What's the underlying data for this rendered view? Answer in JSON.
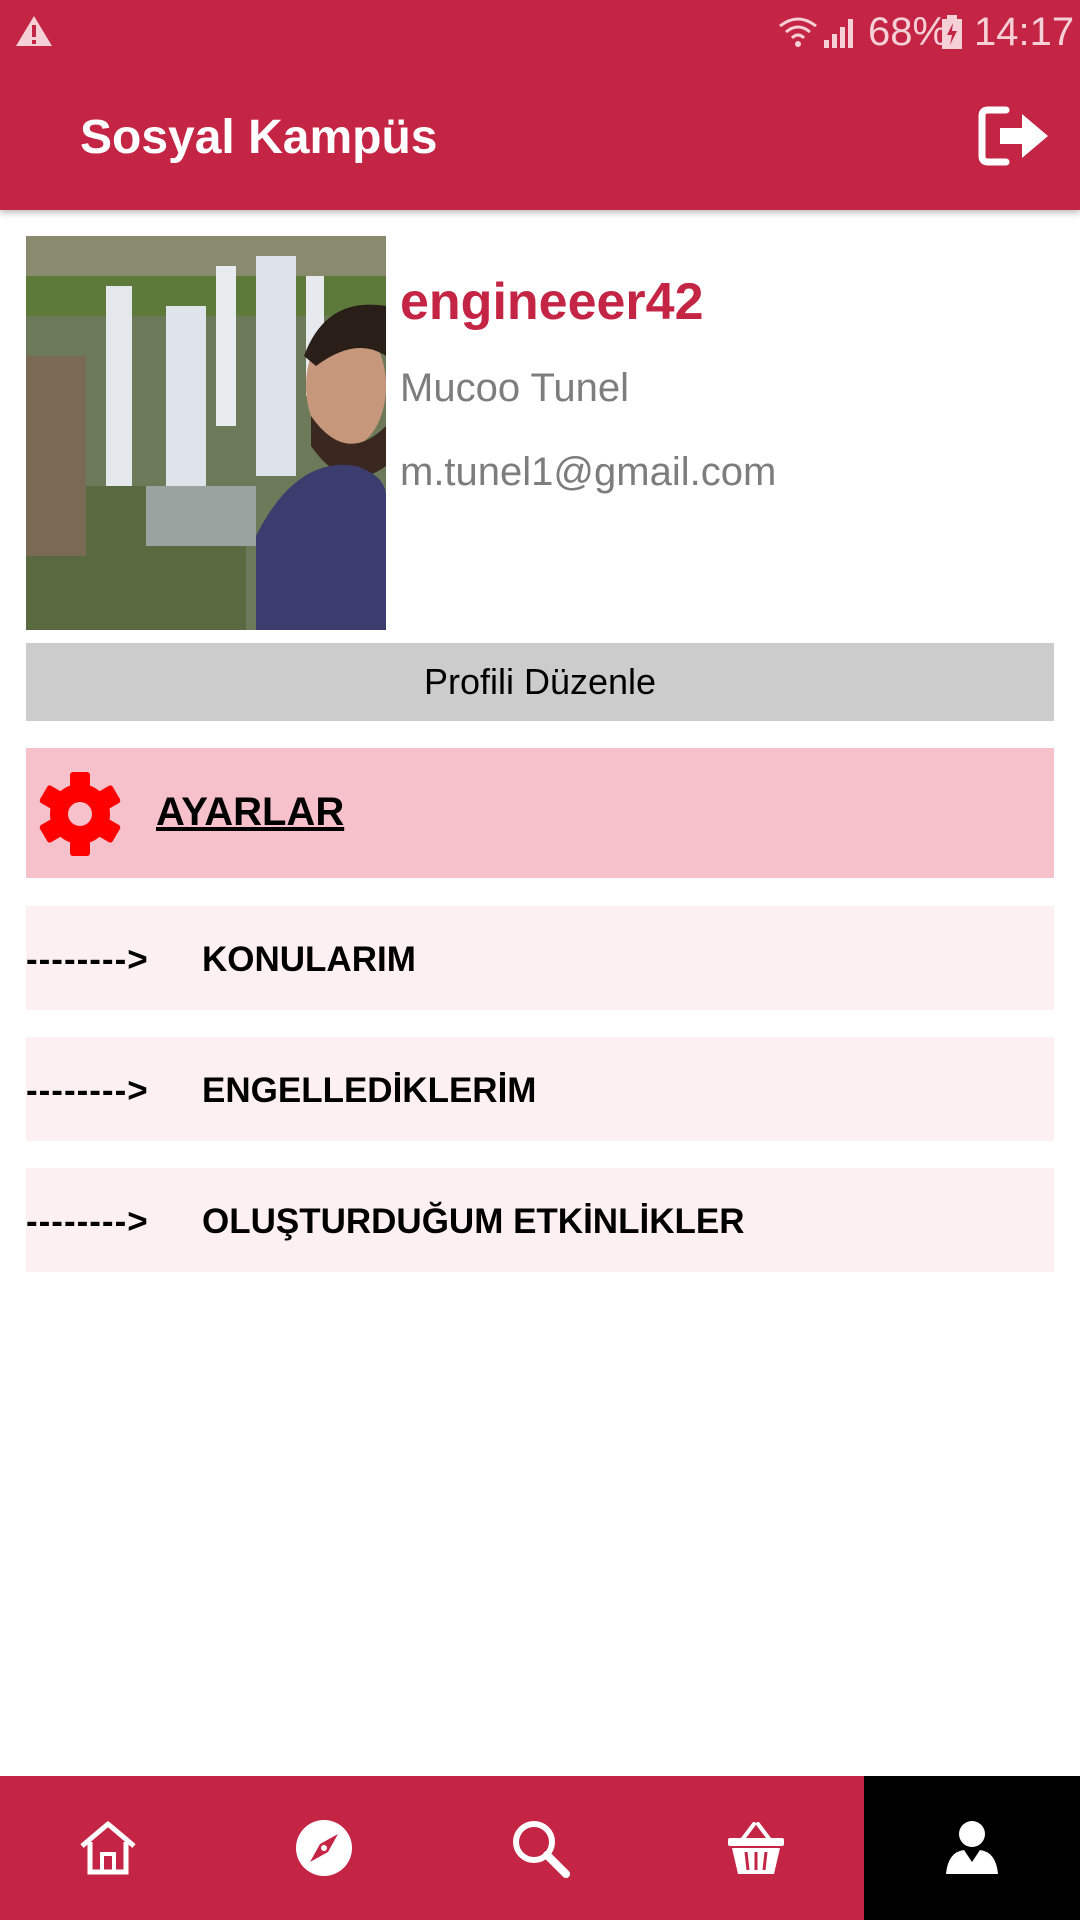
{
  "status_bar": {
    "battery": "68%",
    "time": "14:17"
  },
  "app_bar": {
    "title": "Sosyal Kampüs",
    "logout_icon": "logout-icon"
  },
  "profile": {
    "username": "engineeer42",
    "full_name": "Mucoo Tunel",
    "email": "m.tunel1@gmail.com",
    "edit_button": "Profili Düzenle"
  },
  "settings": {
    "icon": "gear-icon",
    "label": "AYARLAR"
  },
  "menu": [
    {
      "arrow": "-------->",
      "label": "KONULARIM"
    },
    {
      "arrow": "-------->",
      "label": "ENGELLEDİKLERİM"
    },
    {
      "arrow": "-------->",
      "label": "OLUŞTURDUĞUM ETKİNLİKLER"
    }
  ],
  "bottom_nav": {
    "items": [
      "home-icon",
      "compass-icon",
      "search-icon",
      "basket-icon",
      "profile-icon"
    ],
    "active": "profile-icon"
  },
  "colors": {
    "primary": "#c42544",
    "settings_bg": "#f7c1cc",
    "menu_bg": "#fdf0f2",
    "edit_bg": "#cccccc",
    "gear": "#ff0000",
    "nav_active": "#000000"
  }
}
